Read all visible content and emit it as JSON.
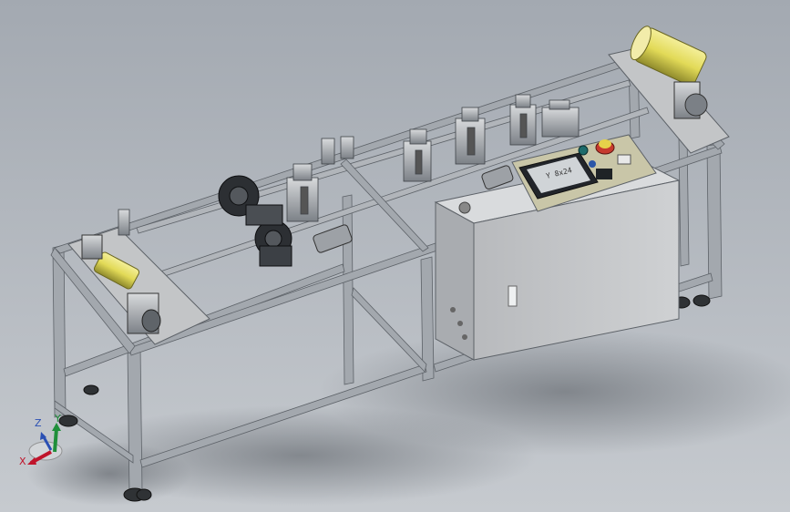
{
  "colors": {
    "background_top": "#a3a9b1",
    "background_bottom": "#c6cacf",
    "frame": "#9aa0a6",
    "frame_dark": "#5d6268",
    "cabinet": "#c7c9cb",
    "plate": "#c3c5c7",
    "roller_yellow": "#e6df68",
    "axis_x": "#c0142b",
    "axis_y": "#1f8f3a",
    "axis_z": "#2a4fb3"
  },
  "triad": {
    "x_label": "X",
    "y_label": "Y",
    "z_label": "Z"
  },
  "hmi": {
    "screen_text": "Y 8x24"
  },
  "icons": [
    "triad-axis-icon",
    "e-stop-icon",
    "indicator-lamp-icon"
  ]
}
